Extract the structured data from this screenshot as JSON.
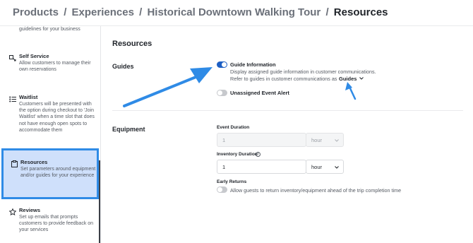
{
  "breadcrumb": {
    "items": [
      "Products",
      "Experiences",
      "Historical Downtown Walking Tour"
    ],
    "current": "Resources",
    "separator": "/"
  },
  "sidebar": {
    "cut_text": "guidelines for your business",
    "items": [
      {
        "title": "Self Service",
        "desc": "Allow customers to manage their own reservations",
        "icon": "self-service-icon"
      },
      {
        "title": "Waitlist",
        "desc": "Customers will be presented with the option during checkout to 'Join Waitlist' when a time slot that does not have enough open spots to accommodate them",
        "icon": "list-icon"
      },
      {
        "title": "Resources",
        "desc": "Set parameters around equipment and/or guides for your experience",
        "icon": "clipboard-icon",
        "active": true
      },
      {
        "title": "Reviews",
        "desc": "Set up emails that prompts customers to provide feedback on your services",
        "icon": "star-icon"
      }
    ]
  },
  "main": {
    "section_title": "Resources",
    "guides": {
      "label": "Guides",
      "guide_information": {
        "title": "Guide Information",
        "enabled": true,
        "desc": "Display assigned guide information in customer communications.",
        "refer_text": "Refer to guides in customer communications as",
        "select_value": "Guides"
      },
      "unassigned_alert": {
        "title": "Unassigned Event Alert",
        "enabled": false
      }
    },
    "equipment": {
      "label": "Equipment",
      "event_duration": {
        "label": "Event Duration",
        "value": "1",
        "unit": "hour",
        "disabled": true
      },
      "inventory_duration": {
        "label": "Inventory Duration",
        "value": "1",
        "unit": "hour"
      },
      "early_returns": {
        "label": "Early Returns",
        "enabled": false,
        "desc": "Allow guests to return inventory/equipment ahead of the trip completion time"
      }
    }
  },
  "colors": {
    "accent": "#1d5fc4",
    "highlight": "#2f8be6",
    "active_bg": "#cfe0fb"
  }
}
